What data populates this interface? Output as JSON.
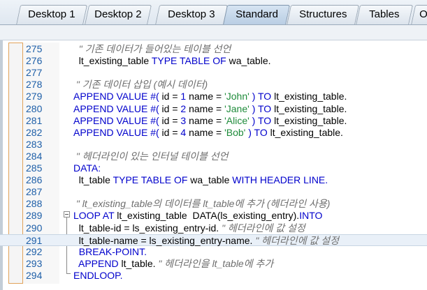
{
  "tabs": [
    {
      "label": "Desktop 1"
    },
    {
      "label": "Desktop 2"
    },
    {
      "label": "Desktop 3"
    },
    {
      "label": "Standard"
    },
    {
      "label": "Structures"
    },
    {
      "label": "Tables"
    },
    {
      "label": "O"
    }
  ],
  "active_tab": "Standard",
  "editor": {
    "current_line": "291",
    "lines": [
      {
        "num": "275",
        "c1": "  \" 기존 데이터가 들어있는 테이블 선언"
      },
      {
        "num": "276",
        "c1": "  lt_existing_table ",
        "k1": "TYPE TABLE OF",
        "c2": " wa_table."
      },
      {
        "num": "277"
      },
      {
        "num": "278",
        "c1": " \" 기존 데이터 삽입 (예시 데이터)"
      },
      {
        "num": "279",
        "k1": "APPEND VALUE #(",
        "c2": " id = ",
        "n1": "1",
        "c3": " name = ",
        "s1": "'John'",
        "k2": " ) TO",
        "c4": " lt_existing_table."
      },
      {
        "num": "280",
        "k1": "APPEND VALUE #(",
        "c2": " id = ",
        "n1": "2",
        "c3": " name = ",
        "s1": "'Jane'",
        "k2": " ) TO",
        "c4": " lt_existing_table."
      },
      {
        "num": "281",
        "k1": "APPEND VALUE #(",
        "c2": " id = ",
        "n1": "3",
        "c3": " name = ",
        "s1": "'Alice'",
        "k2": " ) TO",
        "c4": " lt_existing_table."
      },
      {
        "num": "282",
        "k1": "APPEND VALUE #(",
        "c2": " id = ",
        "n1": "4",
        "c3": " name = ",
        "s1": "'Bob'",
        "k2": " ) TO",
        "c4": " lt_existing_table."
      },
      {
        "num": "283"
      },
      {
        "num": "284",
        "c1": " \" 헤더라인이 있는 인터널 테이블 선언"
      },
      {
        "num": "285",
        "k1": "DATA:"
      },
      {
        "num": "286",
        "c1": "  lt_table ",
        "k1": "TYPE TABLE OF",
        "c2": " wa_table ",
        "k2": "WITH HEADER LINE."
      },
      {
        "num": "287"
      },
      {
        "num": "288",
        "c1": " \" lt_existing_table의 데이터를 lt_table에 추가 (헤더라인 사용)"
      },
      {
        "num": "289",
        "k1": "LOOP AT",
        "c2": " lt_existing_table ",
        "k2": "INTO",
        "c3": " DATA(ls_existing_entry)."
      },
      {
        "num": "290",
        "c1": "  lt_table-id = ls_existing_entry-id. ",
        "cm": "\" 헤더라인에 값 설정"
      },
      {
        "num": "291",
        "c1": "  lt_table-name = ls_existing_entry-name. ",
        "cm": "\" 헤더라인에 값 설정"
      },
      {
        "num": "292",
        "k1": "  BREAK-POINT."
      },
      {
        "num": "293",
        "k1": "  APPEND",
        "c2": " lt_table. ",
        "cm": "\" 헤더라인을 lt_table에 추가"
      },
      {
        "num": "294",
        "k1": "ENDLOOP."
      }
    ]
  },
  "icons": {
    "breakpoint_marker": "current-statement-arrow-icon",
    "fold_toggle": "collapse-block-icon"
  },
  "colors": {
    "keyword": "#0000cc",
    "string": "#1e8b3a",
    "comment": "#6e6e6e",
    "line_number": "#1e5fa8",
    "arrow": "#f0b400"
  }
}
